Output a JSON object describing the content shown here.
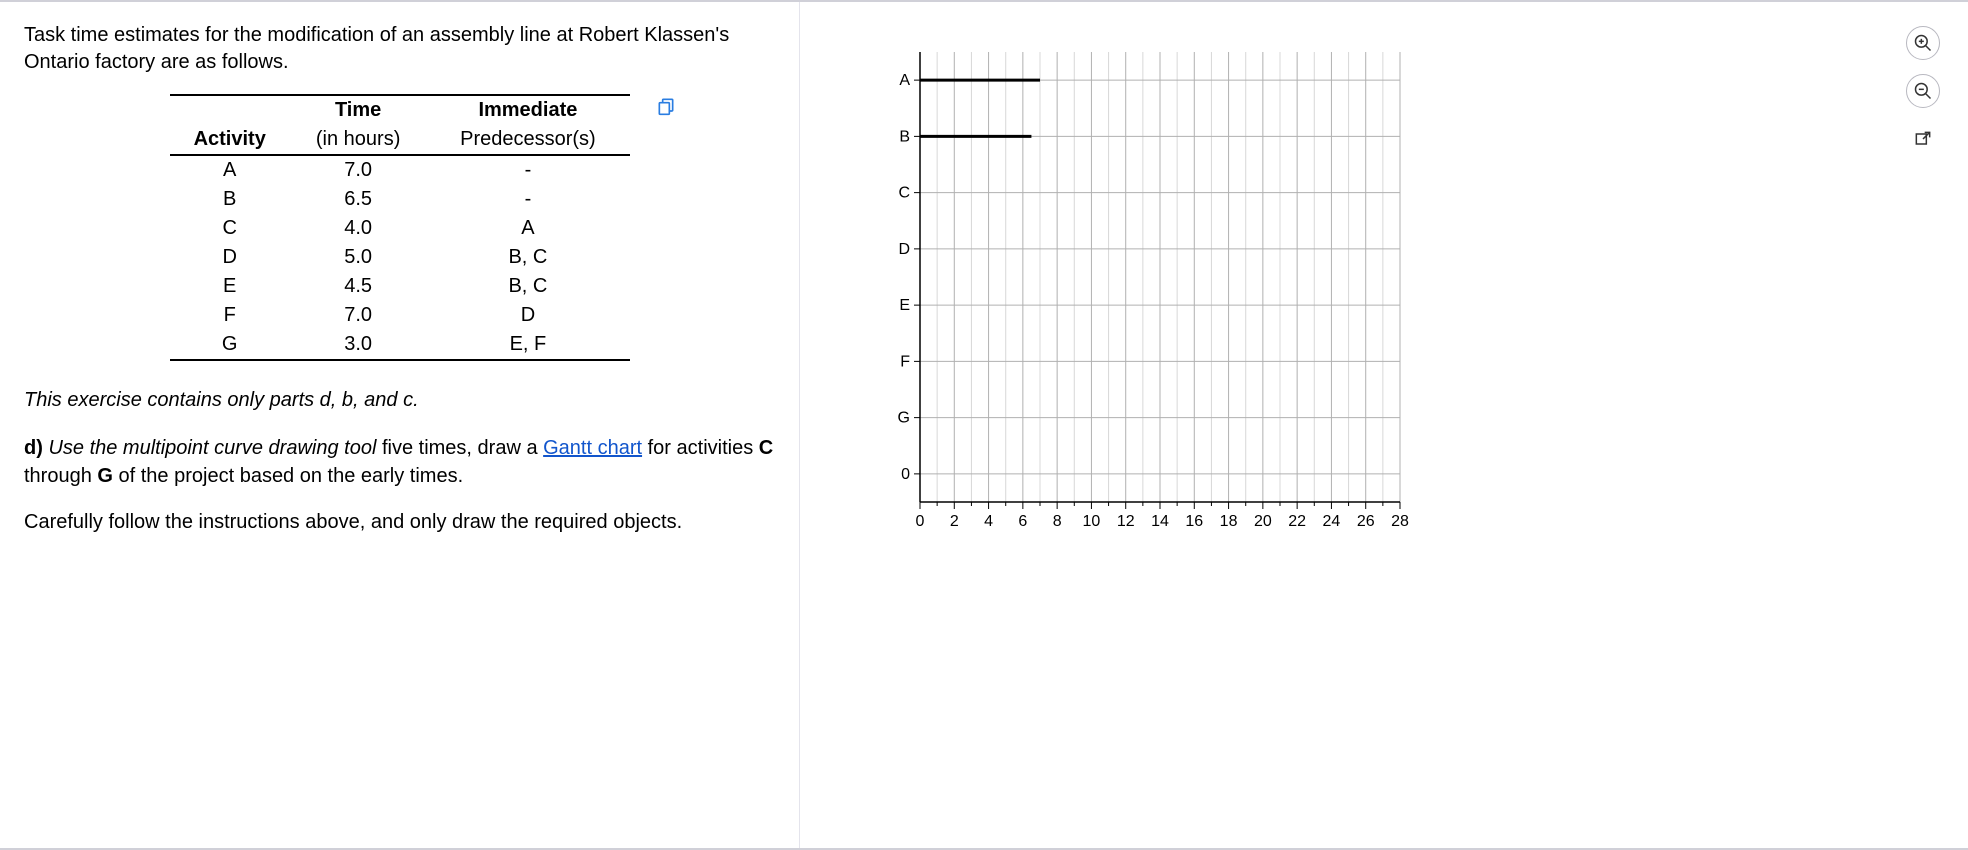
{
  "intro": "Task time estimates for the modification of an assembly line at Robert Klassen's Ontario factory are as follows.",
  "table": {
    "headers": {
      "activity": "Activity",
      "time_l1": "Time",
      "time_l2": "(in hours)",
      "pred_l1": "Immediate",
      "pred_l2": "Predecessor(s)"
    },
    "rows": [
      {
        "activity": "A",
        "time": "7.0",
        "pred": "-"
      },
      {
        "activity": "B",
        "time": "6.5",
        "pred": "-"
      },
      {
        "activity": "C",
        "time": "4.0",
        "pred": "A"
      },
      {
        "activity": "D",
        "time": "5.0",
        "pred": "B, C"
      },
      {
        "activity": "E",
        "time": "4.5",
        "pred": "B, C"
      },
      {
        "activity": "F",
        "time": "7.0",
        "pred": "D"
      },
      {
        "activity": "G",
        "time": "3.0",
        "pred": "E, F"
      }
    ]
  },
  "note": "This exercise contains only parts d, b, and c.",
  "part_d": {
    "label": "d)",
    "lead_ital": "Use the multipoint curve drawing tool",
    "mid": " five times, draw a ",
    "link": "Gantt chart",
    "tail": " for activities ",
    "bold_end": "C",
    "through": " through ",
    "bold_end2": "G",
    "tail2": " of the project based on the early times."
  },
  "follow": "Carefully follow the instructions above, and only draw the required objects.",
  "chart_data": {
    "type": "bar",
    "orientation": "horizontal",
    "y_categories": [
      "A",
      "B",
      "C",
      "D",
      "E",
      "F",
      "G",
      "0"
    ],
    "x_ticks": [
      0,
      2,
      4,
      6,
      8,
      10,
      12,
      14,
      16,
      18,
      20,
      22,
      24,
      26,
      28
    ],
    "xlim": [
      0,
      28
    ],
    "drawn_bars": [
      {
        "activity": "A",
        "start": 0,
        "end": 7.0
      },
      {
        "activity": "B",
        "start": 0,
        "end": 6.5
      }
    ],
    "title": "",
    "xlabel": "",
    "ylabel": ""
  },
  "icons": {
    "zoom_in": "zoom-in",
    "zoom_out": "zoom-out",
    "popout": "popout",
    "copy": "copy"
  }
}
